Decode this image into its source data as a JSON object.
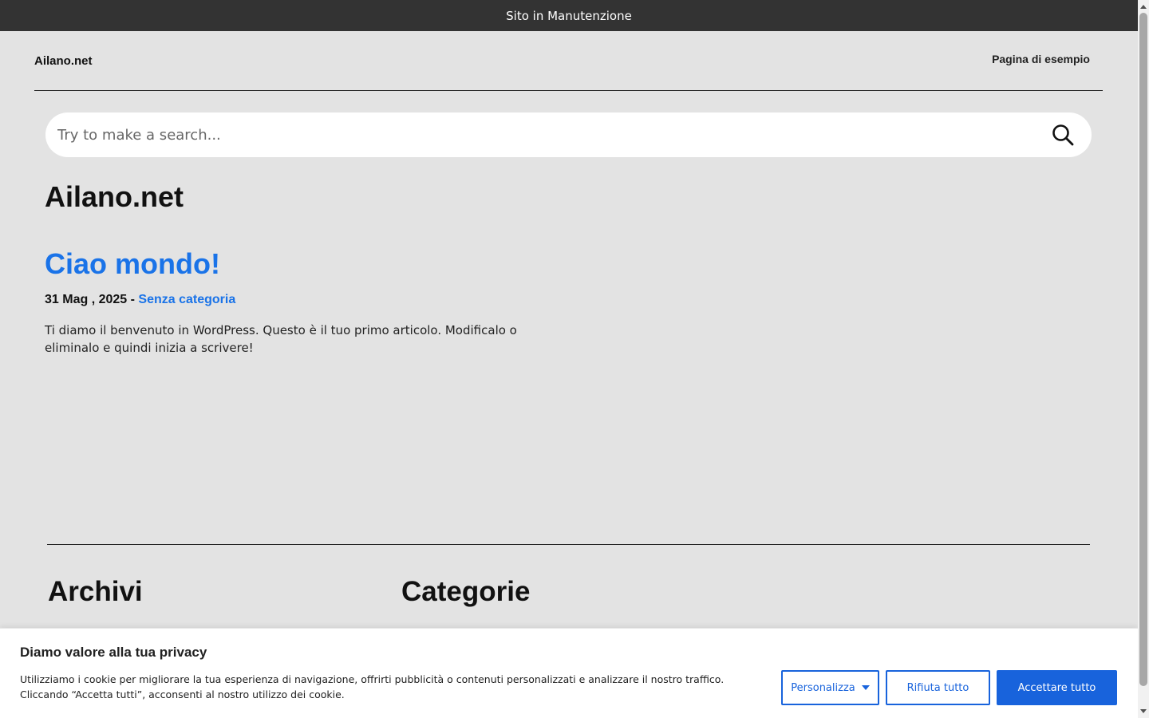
{
  "maintenance_bar": {
    "text": "Sito in Manutenzione"
  },
  "header": {
    "brand": "Ailano.net",
    "nav_link": "Pagina di esempio"
  },
  "search": {
    "placeholder": "Try to make a search...",
    "icon": "search-icon"
  },
  "main": {
    "blog_title": "Ailano.net",
    "post": {
      "title": "Ciao mondo!",
      "date": "31 Mag , 2025",
      "separator": "-",
      "category": "Senza categoria",
      "excerpt": "Ti diamo il benvenuto in WordPress. Questo è il tuo primo articolo. Modificalo o eliminalo e quindi inizia a scrivere!"
    }
  },
  "footer_widgets": {
    "archivi_title": "Archivi",
    "categorie_title": "Categorie"
  },
  "cookie_banner": {
    "title": "Diamo valore alla tua privacy",
    "text": "Utilizziamo i cookie per migliorare la tua esperienza di navigazione, offrirti pubblicità o contenuti personalizzati e analizzare il nostro traffico. Cliccando “Accetta tutti”, acconsenti al nostro utilizzo dei cookie.",
    "customize_label": "Personalizza",
    "reject_label": "Rifiuta tutto",
    "accept_label": "Accettare tutto"
  },
  "colors": {
    "maintenance_bar_bg": "#333333",
    "page_bg": "#e3e3e3",
    "link_blue": "#1a73e8",
    "cookie_accent": "#1863dc"
  }
}
